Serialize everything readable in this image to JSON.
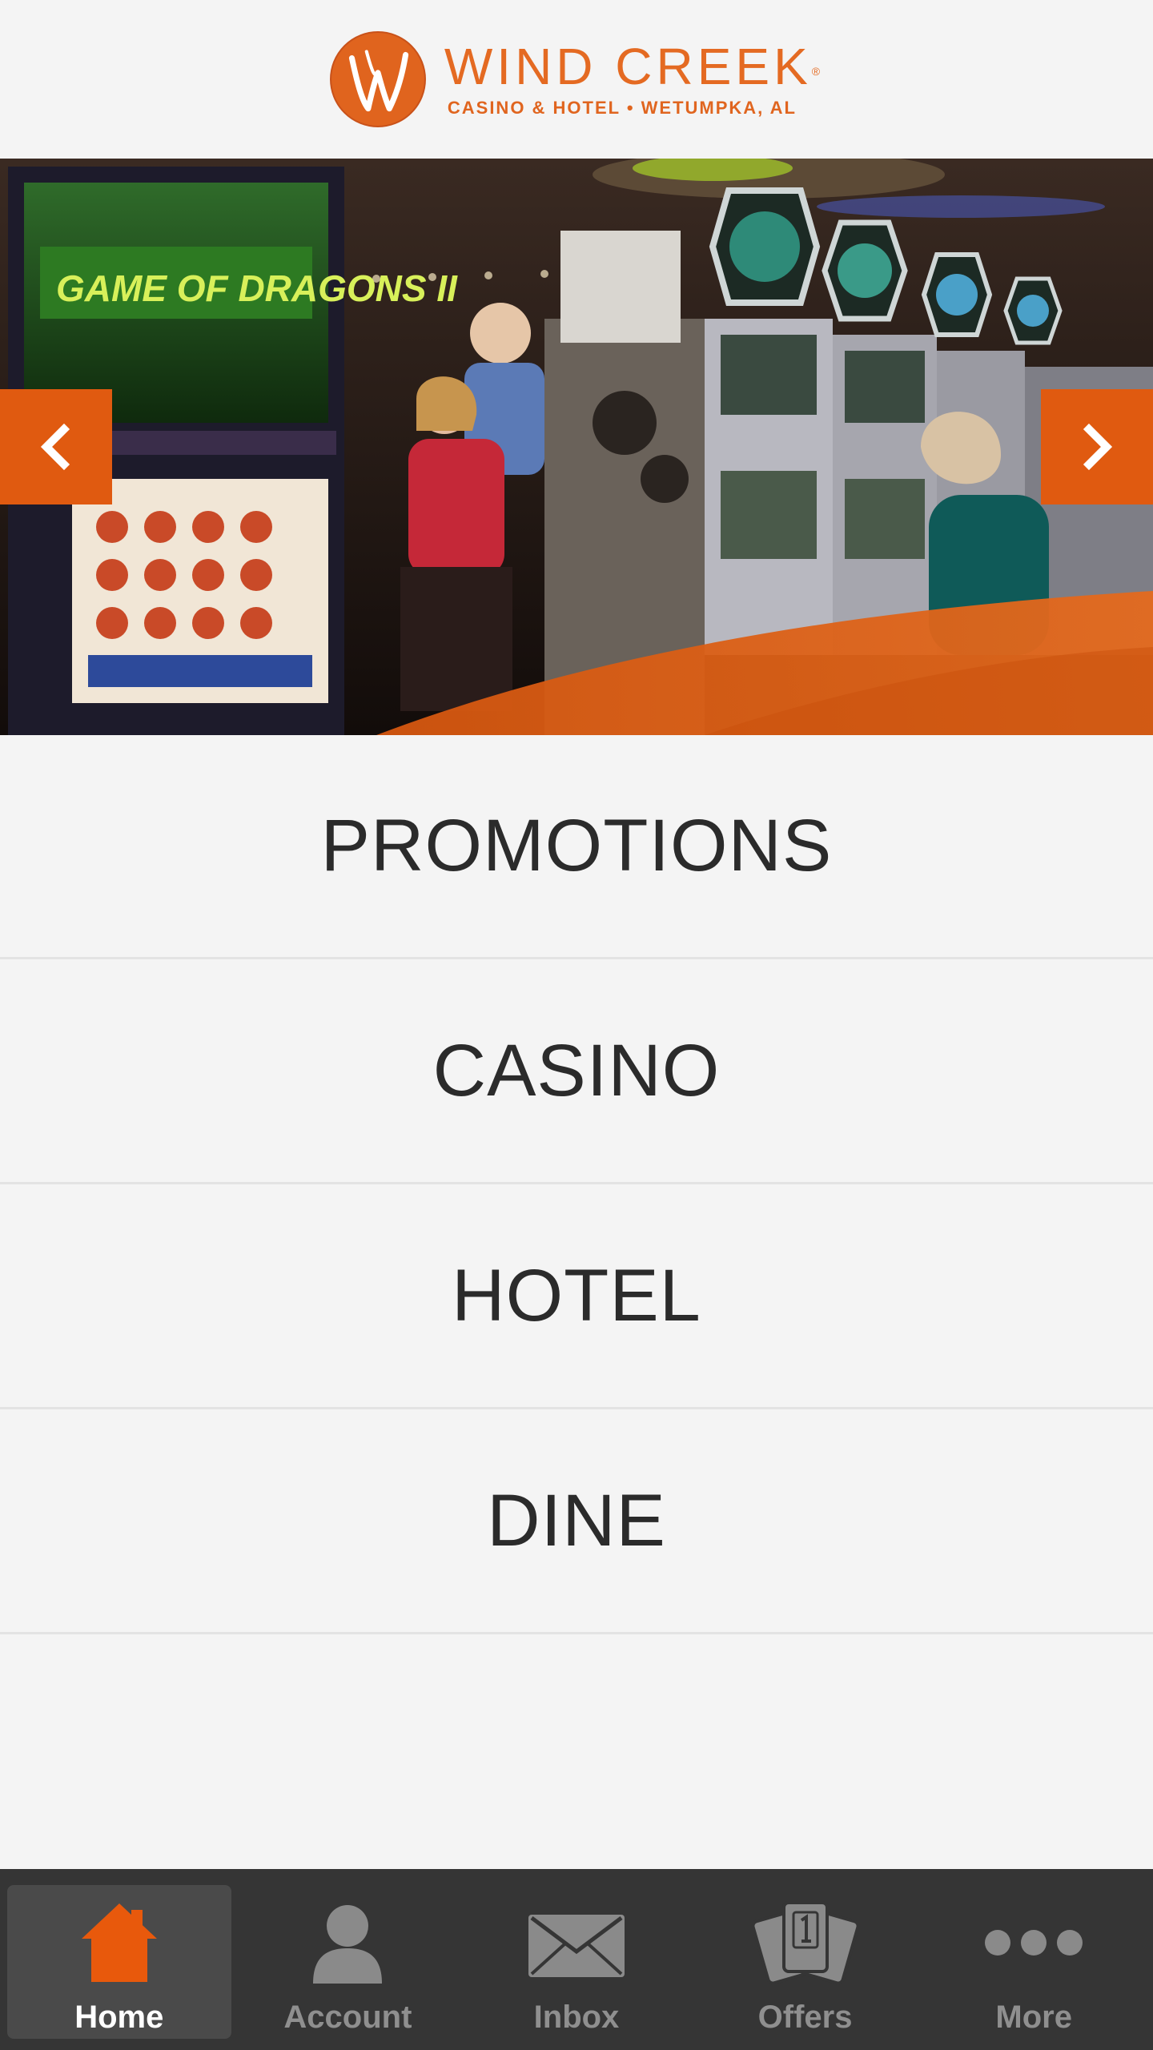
{
  "header": {
    "logo_name": "WIND CREEK",
    "logo_registered": "®",
    "logo_subtitle": "CASINO & HOTEL • WETUMPKA, AL"
  },
  "hero": {
    "machine_title": "GAME OF DRAGONS II",
    "prev_icon": "chevron-left-icon",
    "next_icon": "chevron-right-icon"
  },
  "menu": {
    "items": [
      {
        "label": "PROMOTIONS"
      },
      {
        "label": "CASINO"
      },
      {
        "label": "HOTEL"
      },
      {
        "label": "DINE"
      }
    ]
  },
  "tabbar": {
    "tabs": [
      {
        "label": "Home",
        "icon": "home-icon",
        "active": true
      },
      {
        "label": "Account",
        "icon": "person-icon",
        "active": false
      },
      {
        "label": "Inbox",
        "icon": "envelope-icon",
        "active": false
      },
      {
        "label": "Offers",
        "icon": "cards-icon",
        "active": false
      },
      {
        "label": "More",
        "icon": "more-dots-icon",
        "active": false
      }
    ]
  },
  "colors": {
    "brand_orange": "#e05a10",
    "logo_orange": "#e46a22",
    "tabbar_bg": "#353535",
    "tab_active_bg": "#4a4a4a",
    "page_bg": "#f4f4f4",
    "menu_text": "#2b2b2b"
  }
}
